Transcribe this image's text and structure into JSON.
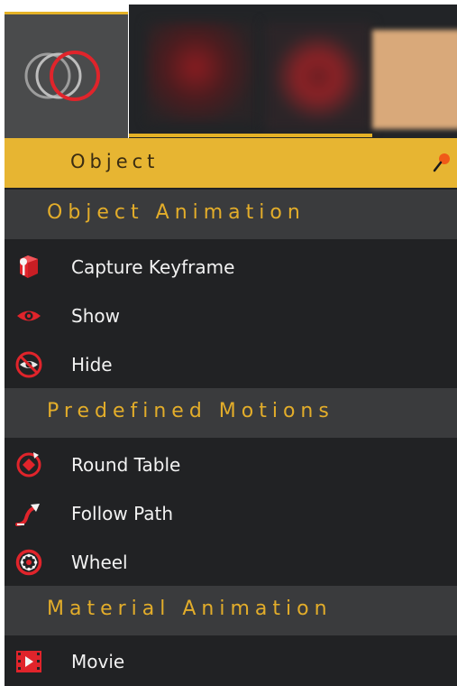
{
  "title_bar": {
    "label": "Object"
  },
  "sections": [
    {
      "header": "Object Animation",
      "items": [
        {
          "label": "Capture Keyframe",
          "icon": "capture-keyframe-icon"
        },
        {
          "label": "Show",
          "icon": "eye-icon"
        },
        {
          "label": "Hide",
          "icon": "eye-off-icon"
        }
      ]
    },
    {
      "header": "Predefined Motions",
      "items": [
        {
          "label": "Round Table",
          "icon": "round-table-icon"
        },
        {
          "label": "Follow Path",
          "icon": "follow-path-icon"
        },
        {
          "label": "Wheel",
          "icon": "wheel-icon"
        }
      ]
    },
    {
      "header": "Material Animation",
      "items": [
        {
          "label": "Movie",
          "icon": "film-icon"
        }
      ]
    }
  ],
  "colors": {
    "accent": "#e7b532",
    "panel_bg": "#212224",
    "section_bg": "#3a3b3d",
    "icon_red": "#e0242b",
    "header_text": "#e3ad2a"
  }
}
